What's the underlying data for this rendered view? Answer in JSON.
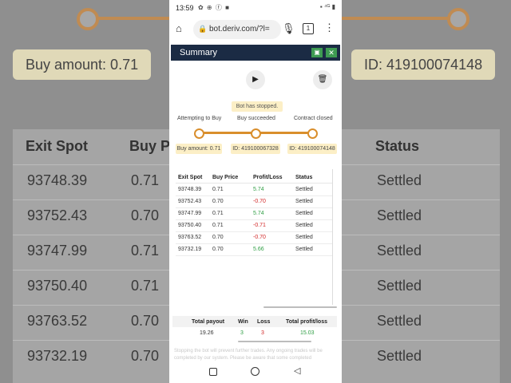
{
  "background": {
    "buy_amount": "Buy amount: 0.71",
    "id": "ID: 419100074148",
    "headers": [
      "Exit Spot",
      "Buy P",
      "Status"
    ],
    "rows": [
      {
        "exit": "93748.39",
        "buy": "0.71",
        "status": "Settled"
      },
      {
        "exit": "93752.43",
        "buy": "0.70",
        "status": "Settled"
      },
      {
        "exit": "93747.99",
        "buy": "0.71",
        "status": "Settled"
      },
      {
        "exit": "93750.40",
        "buy": "0.71",
        "status": "Settled"
      },
      {
        "exit": "93763.52",
        "buy": "0.70",
        "status": "Settled"
      },
      {
        "exit": "93732.19",
        "buy": "0.70",
        "status": "Settled"
      }
    ]
  },
  "statusbar": {
    "time": "13:59",
    "icons": "✿ ⊕ ⓕ ■",
    "right": "▪ ⁴ᴳ ▮"
  },
  "browser": {
    "url": "bot.deriv.com/?l=",
    "tabs": "1"
  },
  "summary": {
    "title": "Summary",
    "status": "Bot has stopped.",
    "steps": [
      "Attempting to Buy",
      "Buy succeeded",
      "Contract closed"
    ],
    "chips": [
      "Buy amount: 0.71",
      "ID: 419100067328",
      "ID: 419100074148"
    ],
    "table": {
      "headers": [
        "Exit Spot",
        "Buy Price",
        "Profit/Loss",
        "Status"
      ],
      "rows": [
        {
          "exit": "93748.39",
          "buy": "0.71",
          "pl": "5.74",
          "status": "Settled"
        },
        {
          "exit": "93752.43",
          "buy": "0.70",
          "pl": "-0.70",
          "status": "Settled"
        },
        {
          "exit": "93747.99",
          "buy": "0.71",
          "pl": "5.74",
          "status": "Settled"
        },
        {
          "exit": "93750.40",
          "buy": "0.71",
          "pl": "-0.71",
          "status": "Settled"
        },
        {
          "exit": "93763.52",
          "buy": "0.70",
          "pl": "-0.70",
          "status": "Settled"
        },
        {
          "exit": "93732.19",
          "buy": "0.70",
          "pl": "5.66",
          "status": "Settled"
        }
      ]
    },
    "totals": {
      "headers": [
        "Total payout",
        "Win",
        "Loss",
        "Total profit/loss"
      ],
      "values": [
        "19.26",
        "3",
        "3",
        "15.03"
      ]
    },
    "note": "Stopping the bot will prevent further trades. Any ongoing trades will be completed by our system. Please be aware that some completed"
  },
  "colors": {
    "accent": "#d98e2c",
    "header_bg": "#1b2b44",
    "positive": "#2f9e44",
    "negative": "#d22828",
    "button": "#3e9b52"
  }
}
